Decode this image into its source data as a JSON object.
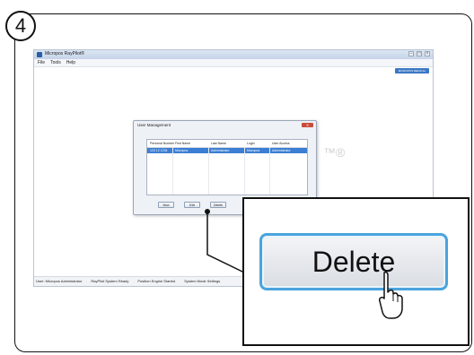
{
  "step": {
    "number": "4"
  },
  "app": {
    "title": "Micropos RayPilot®",
    "menu": [
      "File",
      "Tools",
      "Help"
    ],
    "header_pill": "MICROPOS MEDICAL",
    "watermark": "™®",
    "status": [
      "User: Micropos Administrator",
      "RayPilot System Ready",
      "Position Engine Started",
      "System Mode Settings"
    ]
  },
  "dialog": {
    "title": "User Management",
    "columns": [
      "Personal Number",
      "First Name",
      "Last Name",
      "Login",
      "User Access"
    ],
    "rows": [
      [
        "123 12 1234",
        "Micropos",
        "Administrator",
        "Micropos",
        "Administrator"
      ]
    ],
    "buttons": {
      "new": "New",
      "edit": "Edit",
      "delete": "Delete"
    }
  },
  "zoom": {
    "button_label": "Delete"
  },
  "colors": {
    "accent": "#4aa4dd",
    "selection": "#3b7ed3",
    "close": "#c94b3a"
  }
}
